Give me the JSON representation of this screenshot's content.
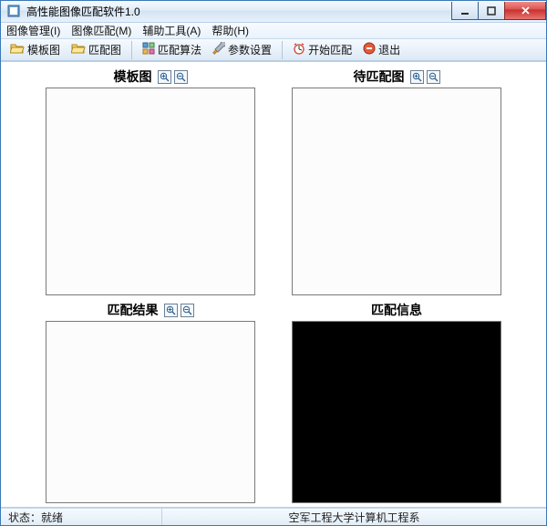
{
  "window": {
    "title": "高性能图像匹配软件1.0"
  },
  "menu": {
    "image_manage": "图像管理(I)",
    "image_match": "图像匹配(M)",
    "aux_tools": "辅助工具(A)",
    "help": "帮助(H)"
  },
  "toolbar": {
    "template": "模板图",
    "match": "匹配图",
    "algorithm": "匹配算法",
    "params": "参数设置",
    "start": "开始匹配",
    "exit": "退出"
  },
  "panes": {
    "template": {
      "title": "模板图"
    },
    "tomatch": {
      "title": "待匹配图"
    },
    "result": {
      "title": "匹配结果"
    },
    "info": {
      "title": "匹配信息"
    }
  },
  "status": {
    "label": "状态：",
    "value": "就绪",
    "org": "空军工程大学计算机工程系"
  },
  "colors": {
    "accent": "#3b79b7",
    "close": "#d9534f"
  },
  "icons": {
    "app": "app-icon",
    "folder": "folder-open-icon",
    "algo": "grid-icon",
    "wrench": "wrench-icon",
    "clock": "clock-icon",
    "stop": "stop-icon",
    "zoom_in": "zoom-in-icon",
    "zoom_out": "zoom-out-icon"
  }
}
